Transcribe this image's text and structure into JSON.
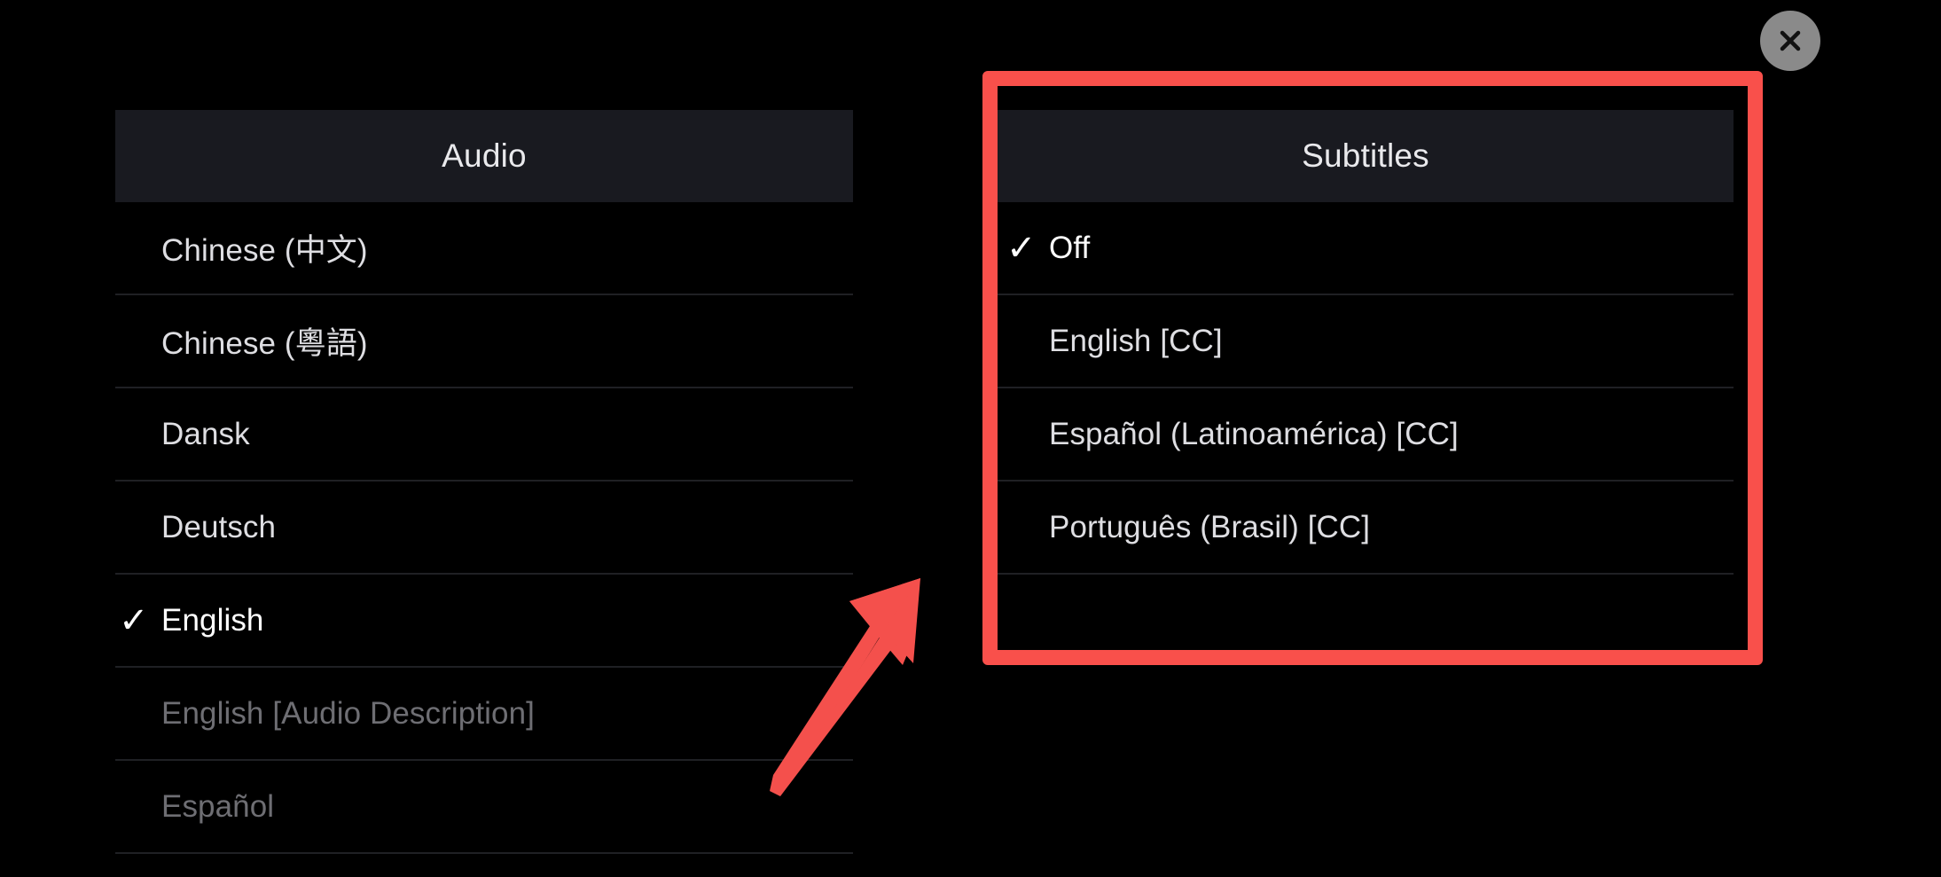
{
  "window": {
    "background_color": "#000000",
    "close_button": {
      "icon": "close-icon",
      "label": "Close",
      "circle_color": "#8a8a8a",
      "glyph_color": "#111111"
    }
  },
  "annotations": {
    "highlight_color": "#f9504b",
    "highlight_target": "Subtitles",
    "arrow_color": "#f4504c",
    "arrow_direction": "up-right"
  },
  "audio": {
    "header": "Audio",
    "items": [
      {
        "label": "Chinese (中文)",
        "selected": false,
        "disabled": false,
        "check": ""
      },
      {
        "label": "Chinese (粵語)",
        "selected": false,
        "disabled": false,
        "check": ""
      },
      {
        "label": "Dansk",
        "selected": false,
        "disabled": false,
        "check": ""
      },
      {
        "label": "Deutsch",
        "selected": false,
        "disabled": false,
        "check": ""
      },
      {
        "label": "English",
        "selected": true,
        "disabled": false,
        "check": "✓"
      },
      {
        "label": "English [Audio Description]",
        "selected": false,
        "disabled": true,
        "check": ""
      },
      {
        "label": "Español",
        "selected": false,
        "disabled": true,
        "check": ""
      }
    ]
  },
  "subtitles": {
    "header": "Subtitles",
    "items": [
      {
        "label": "Off",
        "selected": true,
        "disabled": false,
        "check": "✓"
      },
      {
        "label": "English [CC]",
        "selected": false,
        "disabled": false,
        "check": ""
      },
      {
        "label": "Español (Latinoamérica) [CC]",
        "selected": false,
        "disabled": false,
        "check": ""
      },
      {
        "label": "Português (Brasil) [CC]",
        "selected": false,
        "disabled": false,
        "check": ""
      }
    ]
  }
}
